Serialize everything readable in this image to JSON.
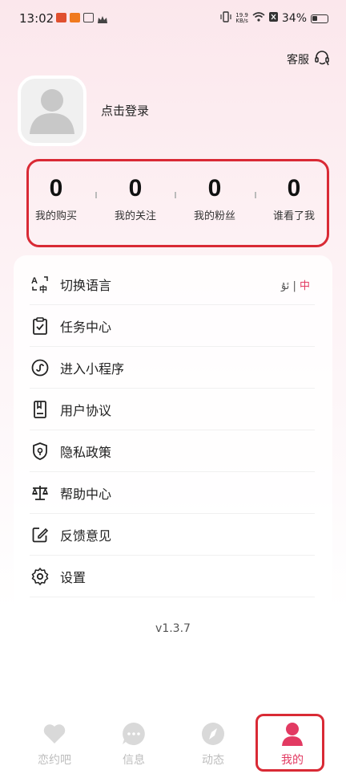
{
  "status_bar": {
    "time": "13:02",
    "net_speed_value": "19.9",
    "net_speed_unit": "KB/s",
    "battery": "34%"
  },
  "header": {
    "service_label": "客服"
  },
  "profile": {
    "login_text": "点击登录"
  },
  "stats": [
    {
      "value": "0",
      "label": "我的购买"
    },
    {
      "value": "0",
      "label": "我的关注"
    },
    {
      "value": "0",
      "label": "我的粉丝"
    },
    {
      "value": "0",
      "label": "谁看了我"
    }
  ],
  "menu": {
    "items": [
      {
        "label": "切换语言",
        "icon": "translate-icon"
      },
      {
        "label": "任务中心",
        "icon": "clipboard-check-icon"
      },
      {
        "label": "进入小程序",
        "icon": "mini-program-icon"
      },
      {
        "label": "用户协议",
        "icon": "document-icon"
      },
      {
        "label": "隐私政策",
        "icon": "shield-icon"
      },
      {
        "label": "帮助中心",
        "icon": "scale-icon"
      },
      {
        "label": "反馈意见",
        "icon": "edit-icon"
      },
      {
        "label": "设置",
        "icon": "gear-icon"
      }
    ],
    "language": {
      "option_a": "ئۇ",
      "separator": "|",
      "option_b": "中"
    }
  },
  "version": "v1.3.7",
  "tabs": [
    {
      "label": "恋约吧",
      "icon": "heart-icon"
    },
    {
      "label": "信息",
      "icon": "chat-icon"
    },
    {
      "label": "动态",
      "icon": "compass-icon"
    },
    {
      "label": "我的",
      "icon": "person-icon"
    }
  ],
  "colors": {
    "accent": "#e23a62",
    "highlight_border": "#d92a35",
    "tab_inactive": "#bdbdbd"
  }
}
